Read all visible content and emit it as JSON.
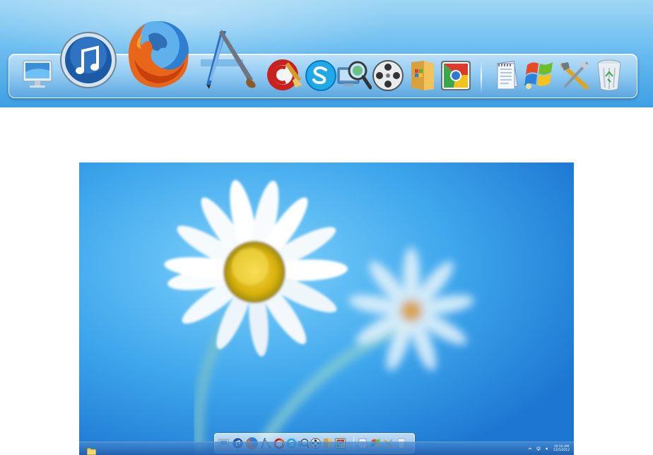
{
  "dock": {
    "icons": [
      {
        "name": "computer"
      },
      {
        "name": "itunes"
      },
      {
        "name": "firefox"
      },
      {
        "name": "paint-brush"
      },
      {
        "name": "ccleaner"
      },
      {
        "name": "skype"
      },
      {
        "name": "network-search"
      },
      {
        "name": "video-reel"
      },
      {
        "name": "windows-folder"
      },
      {
        "name": "chrome"
      },
      {
        "name": "notepad"
      },
      {
        "name": "windows-xp"
      },
      {
        "name": "tools"
      },
      {
        "name": "recycle-bin"
      }
    ]
  },
  "desktop": {
    "taskbar": {
      "clock_time": "10:16 AM",
      "clock_date": "12/5/2012"
    }
  },
  "colors": {
    "wallpaper_blue": "#3ea6ec",
    "flower_center": "#e8c21a"
  }
}
